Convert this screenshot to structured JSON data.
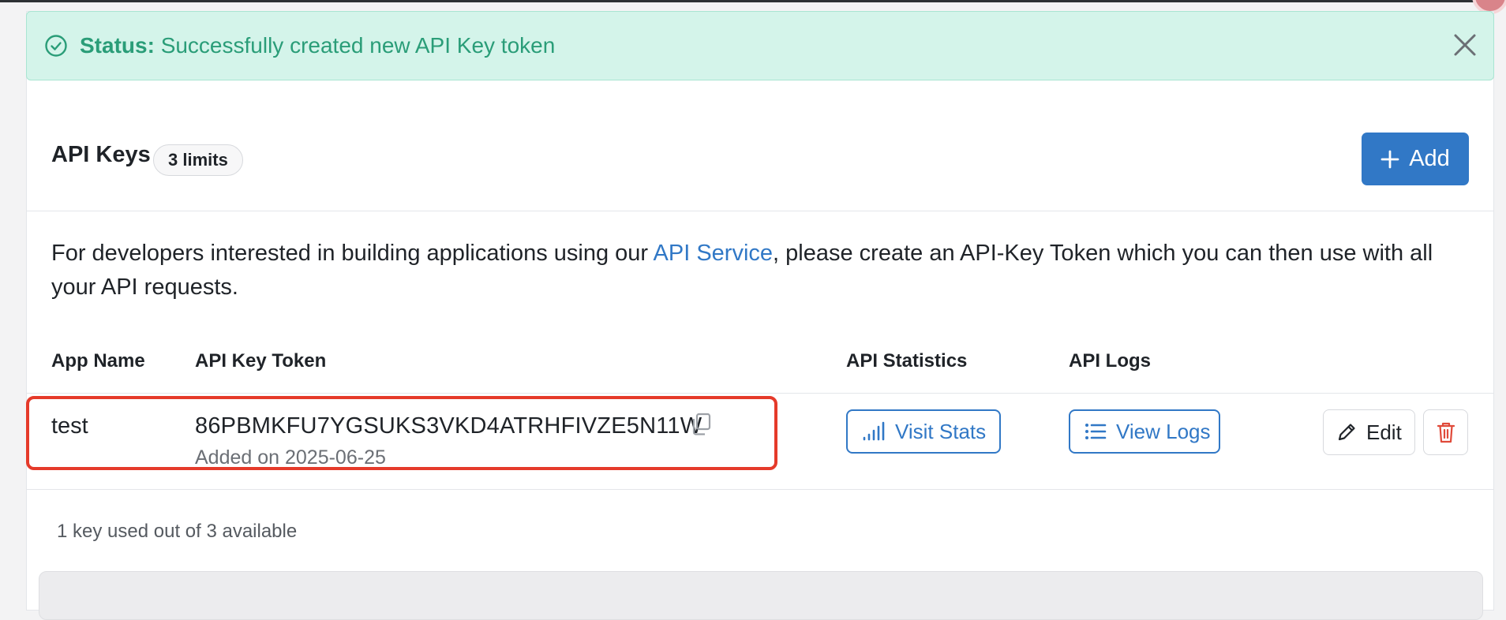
{
  "alert": {
    "status_label": "Status:",
    "message": "Successfully created new API Key token",
    "icons": {
      "status": "check-circle-icon",
      "close": "close-icon"
    }
  },
  "header": {
    "title": "API Keys",
    "limits_badge": "3 limits",
    "add_button": "Add"
  },
  "description": {
    "before_link": "For developers interested in building applications using our ",
    "link_text": "API Service",
    "after_link": ", please create an API-Key Token which you can then use with all your API requests."
  },
  "table": {
    "columns": [
      "App Name",
      "API Key Token",
      "API Statistics",
      "API Logs"
    ],
    "rows": [
      {
        "app_name": "test",
        "token": "86PBMKFU7YGSUKS3VKD4ATRHFIVZE5N11W",
        "added": "Added on 2025-06-25",
        "stats_button": "Visit Stats",
        "logs_button": "View Logs",
        "edit_button": "Edit"
      }
    ]
  },
  "usage": "1 key used out of 3 available",
  "colors": {
    "accent": "#3178c6",
    "success_bg": "#d4f4ea",
    "success_text": "#2a9d78",
    "highlight": "#e53a2a",
    "danger": "#e04a3a"
  }
}
